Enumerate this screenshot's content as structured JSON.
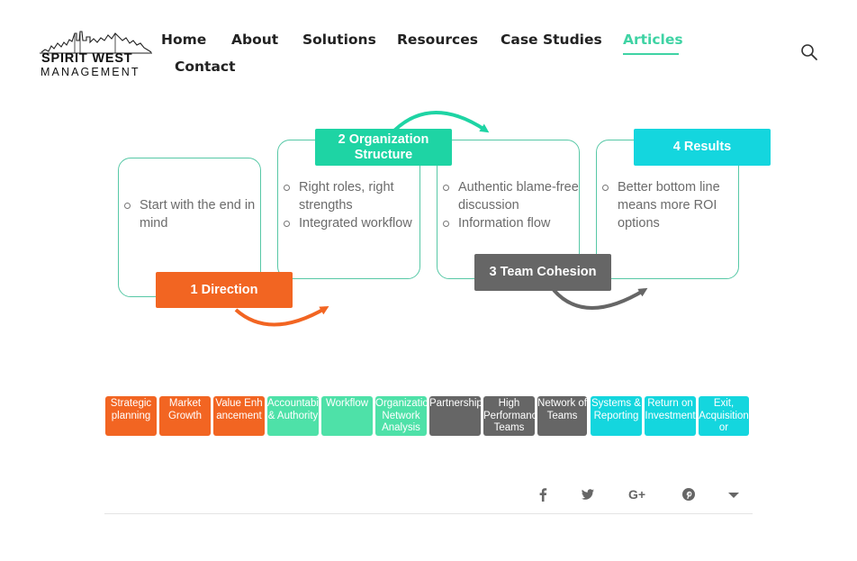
{
  "logo": {
    "line1": "SPIRIT WEST",
    "line2": "MANAGEMENT"
  },
  "nav": {
    "items": [
      {
        "label": "Home"
      },
      {
        "label": "About"
      },
      {
        "label": "Solutions"
      },
      {
        "label": "Resources"
      },
      {
        "label": "Case Studies"
      },
      {
        "label": "Articles",
        "active": true
      },
      {
        "label": "Contact"
      }
    ]
  },
  "colors": {
    "accent": "#3fd3a4",
    "orange": "#f26522",
    "green": "#4ee1a8",
    "gray": "#666666",
    "cyan": "#14d6de"
  },
  "diagram": {
    "steps": [
      {
        "label": "1 Direction",
        "bullets": [
          "Start with the end in mind"
        ]
      },
      {
        "label": "2 Organization Structure",
        "bullets": [
          "Right roles, right strengths",
          "Integrated workflow"
        ]
      },
      {
        "label": "3 Team Cohesion",
        "bullets": [
          "Authentic blame-free discussion",
          "Information flow"
        ]
      },
      {
        "label": "4 Results",
        "bullets": [
          "Better bottom line means more ROI options"
        ]
      }
    ]
  },
  "tiles": [
    {
      "label": "Strategic planning",
      "color": "orange"
    },
    {
      "label": "Market Growth",
      "color": "orange"
    },
    {
      "label": "Value Enhancement",
      "color": "orange"
    },
    {
      "label": "Accountability & Authority",
      "color": "green"
    },
    {
      "label": "Workflow",
      "color": "green"
    },
    {
      "label": "Organization Network Analysis",
      "color": "green"
    },
    {
      "label": "Partnerships",
      "color": "gray"
    },
    {
      "label": "High Performance Teams",
      "color": "gray"
    },
    {
      "label": "Network of Teams",
      "color": "gray"
    },
    {
      "label": "Systems & Reporting",
      "color": "cyan"
    },
    {
      "label": "Return on Investment",
      "color": "cyan"
    },
    {
      "label": "Exit, Acquisition or",
      "color": "cyan"
    }
  ],
  "share": {
    "icons": [
      "facebook-icon",
      "twitter-icon",
      "google-plus-icon",
      "pinterest-icon",
      "dropdown-caret-icon"
    ]
  }
}
